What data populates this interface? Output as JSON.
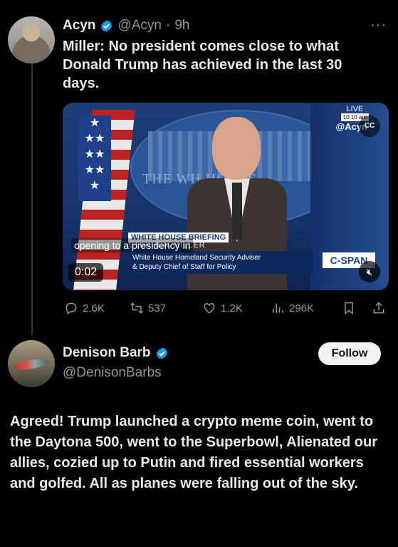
{
  "tweet": {
    "author_name": "Acyn",
    "author_handle": "@Acyn",
    "time_sep": "·",
    "time": "9h",
    "more": "···",
    "text": "Miller: No president comes close to what Donald Trump has achieved in the last 30 days.",
    "media": {
      "caption": "opening to a presidency in",
      "live_label": "LIVE",
      "live_time": "10:10 am",
      "watermark": "@Acyn",
      "cc_label": "CC",
      "seal_text": "THE WH      HOUSE",
      "lower_third_tag": "WHITE HOUSE BRIEFING",
      "lower_third_name": "STEPHEN MILLER",
      "lower_third_line1": "White House Homeland Security Adviser",
      "lower_third_line2": "& Deputy Chief of Staff for Policy",
      "network": "C-SPAN",
      "duration": "0:02",
      "mute_icon": "muted-speaker-icon"
    },
    "actions": {
      "replies": "2.6K",
      "reposts": "537",
      "likes": "1.2K",
      "views": "296K"
    }
  },
  "reply": {
    "author_name": "Denison Barb",
    "author_handle": "@DenisonBarbs",
    "follow_label": "Follow",
    "text": "Agreed! Trump launched a crypto meme coin, went to the Daytona 500, went to the Superbowl, Alienated our allies, cozied up to Putin and fired essential workers and golfed. All as planes were falling out of the sky."
  },
  "colors": {
    "background": "#000000",
    "verified": "#1d9bf0",
    "muted_text": "#8b98a5"
  }
}
